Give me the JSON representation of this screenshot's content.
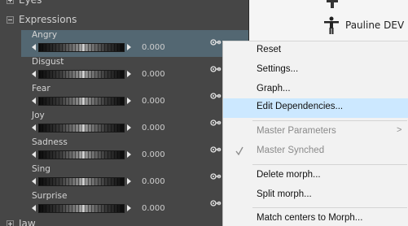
{
  "panel": {
    "top_group_label": "Eyes",
    "expressions_label": "Expressions",
    "jaw_label": "Jaw",
    "morphs": [
      {
        "name": "Angry",
        "value": "0.000"
      },
      {
        "name": "Disgust",
        "value": "0.000"
      },
      {
        "name": "Fear",
        "value": "0.000"
      },
      {
        "name": "Joy",
        "value": "0.000"
      },
      {
        "name": "Sadness",
        "value": "0.000"
      },
      {
        "name": "Sing",
        "value": "0.000"
      },
      {
        "name": "Surprise",
        "value": "0.000"
      }
    ],
    "link_icon": "link-icon"
  },
  "scene": {
    "node_label": "Pauline DEV",
    "node_icon": "figure-icon"
  },
  "menu": {
    "reset": "Reset",
    "settings": "Settings...",
    "graph": "Graph...",
    "edit_dependencies": "Edit Dependencies...",
    "master_parameters": "Master Parameters",
    "master_parameters_arrow": ">",
    "master_synched": "Master Synched",
    "delete_morph": "Delete morph...",
    "split_morph": "Split morph...",
    "match_centers": "Match centers to Morph..."
  },
  "colors": {
    "selected_row": "#536772",
    "menu_highlight": "#cce8ff",
    "panel_bg": "#464646"
  }
}
